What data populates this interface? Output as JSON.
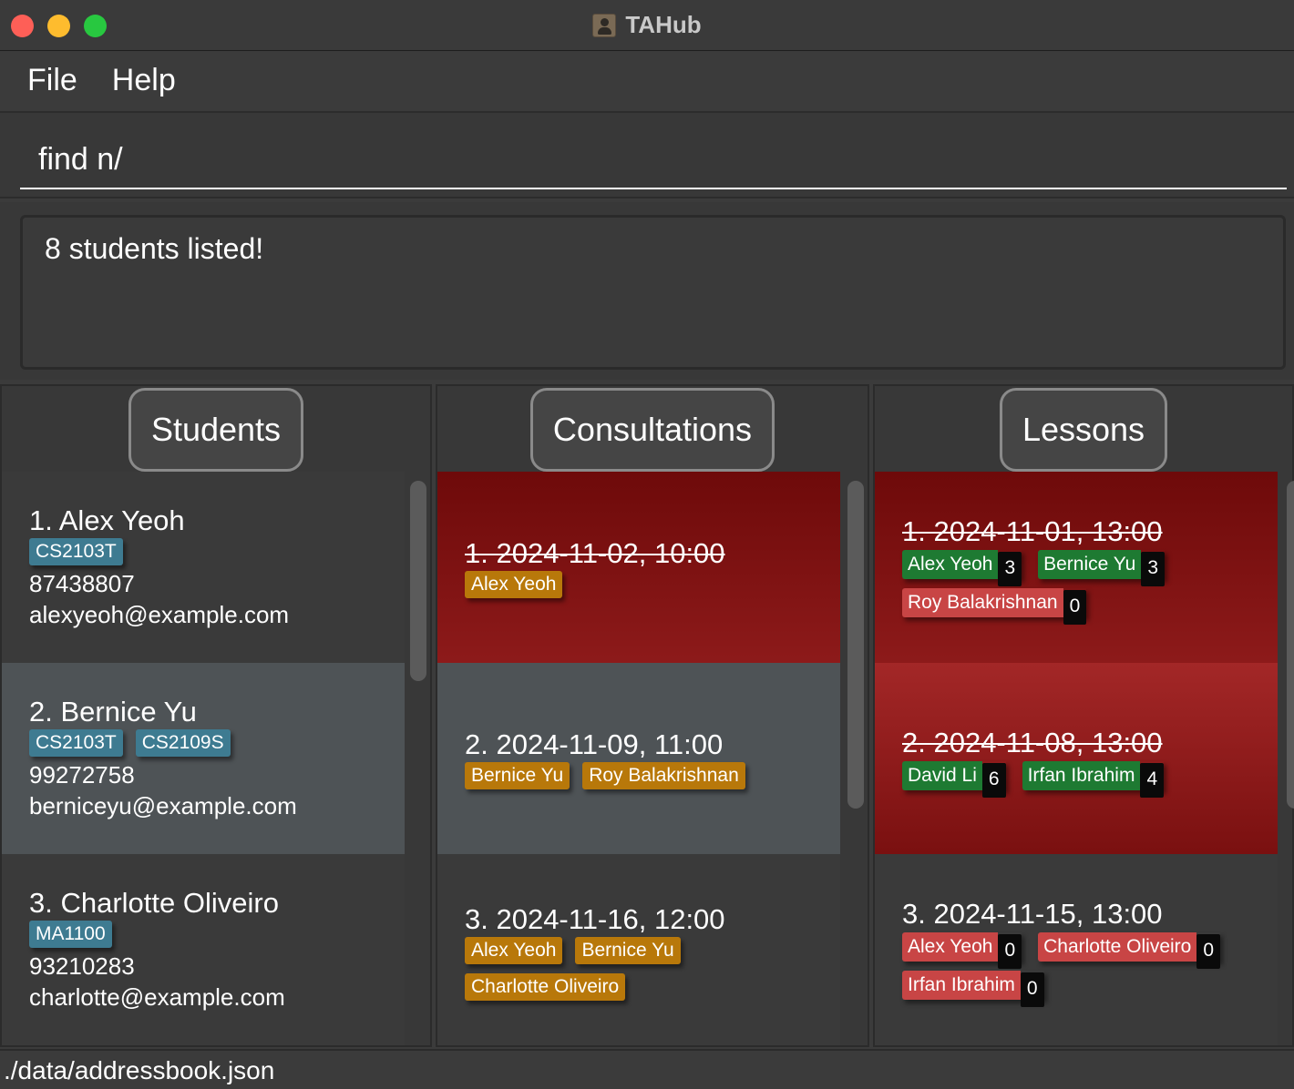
{
  "window": {
    "title": "TAHub"
  },
  "menu": {
    "file": "File",
    "help": "Help"
  },
  "command": {
    "value": "find n/"
  },
  "result": {
    "text": "8 students listed!"
  },
  "columns": {
    "students": "Students",
    "consultations": "Consultations",
    "lessons": "Lessons"
  },
  "students": [
    {
      "name": "1. Alex Yeoh",
      "modules": [
        "CS2103T"
      ],
      "phone": "87438807",
      "email": "alexyeoh@example.com"
    },
    {
      "name": "2. Bernice Yu",
      "modules": [
        "CS2103T",
        "CS2109S"
      ],
      "phone": "99272758",
      "email": "berniceyu@example.com"
    },
    {
      "name": "3. Charlotte Oliveiro",
      "modules": [
        "MA1100"
      ],
      "phone": "93210283",
      "email": "charlotte@example.com"
    }
  ],
  "consultations": [
    {
      "date": "1. 2024-11-02, 10:00",
      "students": [
        "Alex Yeoh"
      ]
    },
    {
      "date": "2. 2024-11-09, 11:00",
      "students": [
        "Bernice Yu",
        "Roy Balakrishnan"
      ]
    },
    {
      "date": "3. 2024-11-16, 12:00",
      "students": [
        "Alex Yeoh",
        "Bernice Yu",
        "Charlotte Oliveiro"
      ]
    }
  ],
  "lessons": [
    {
      "date": "1. 2024-11-01, 13:00",
      "attendees": [
        {
          "name": "Alex Yeoh",
          "count": "3"
        },
        {
          "name": "Bernice Yu",
          "count": "3"
        },
        {
          "name": "Roy Balakrishnan",
          "count": "0"
        }
      ]
    },
    {
      "date": "2. 2024-11-08, 13:00",
      "attendees": [
        {
          "name": "David Li",
          "count": "6"
        },
        {
          "name": "Irfan Ibrahim",
          "count": "4"
        }
      ]
    },
    {
      "date": "3. 2024-11-15, 13:00",
      "attendees": [
        {
          "name": "Alex Yeoh",
          "count": "0"
        },
        {
          "name": "Charlotte Oliveiro",
          "count": "0"
        },
        {
          "name": "Irfan Ibrahim",
          "count": "0"
        }
      ]
    }
  ],
  "status": {
    "path": "./data/addressbook.json"
  },
  "colors": {
    "module_tag": "#3e7b91",
    "consult_tag": "#b8780a",
    "attended_chip": "#1e7a32",
    "absent_chip": "#c84545",
    "past_card": "#8d1a1a"
  }
}
